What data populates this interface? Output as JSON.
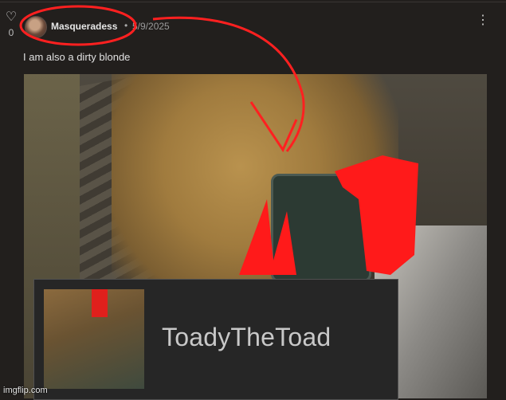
{
  "post": {
    "like_count": "0",
    "username": "Masqueradess",
    "separator": "•",
    "date": "5/9/2025",
    "text": "I am also a dirty blonde"
  },
  "overlay": {
    "name": "ToadyTheToad"
  },
  "watermark": "imgflip.com",
  "icons": [
    "heart-icon",
    "more-vertical-icon",
    "avatar"
  ],
  "colors": {
    "background": "#221f1d",
    "annotation_red": "#ff2020"
  }
}
